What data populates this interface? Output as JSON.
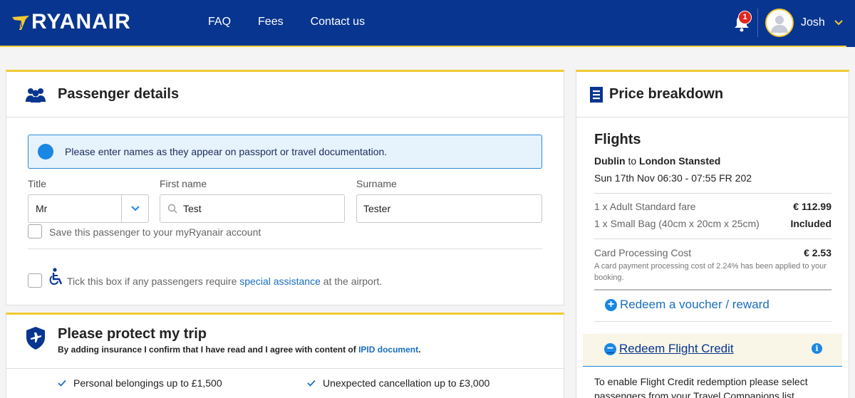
{
  "header": {
    "brand": "RYANAIR",
    "nav": [
      "FAQ",
      "Fees",
      "Contact us"
    ],
    "notification_count": "1",
    "user_name": "Josh"
  },
  "passenger": {
    "title": "Passenger details",
    "info_text": "Please enter names as they appear on passport or travel documentation.",
    "labels": {
      "title": "Title",
      "first_name": "First name",
      "surname": "Surname"
    },
    "values": {
      "title": "Mr",
      "first_name": "Test",
      "surname": "Tester"
    },
    "save_passenger": "Save this passenger to your myRyanair account",
    "assistance": {
      "prefix": "Tick this box if any passengers require ",
      "link": "special assistance",
      "suffix": " at the airport."
    }
  },
  "protect": {
    "title": "Please protect my trip",
    "subtitle_prefix": "By adding insurance I confirm that I have read and I agree with content of ",
    "subtitle_link": "IPID document",
    "subtitle_suffix": ".",
    "benefits": [
      "Personal belongings up to £1,500",
      "Unexpected cancellation up to £3,000"
    ]
  },
  "price": {
    "title": "Price breakdown",
    "section": "Flights",
    "origin": "Dublin",
    "route_join": "to",
    "destination": "London Stansted",
    "flight_time": "Sun 17th Nov 06:30 - 07:55 FR 202",
    "rows": [
      {
        "label": "1 x Adult Standard fare",
        "value": "€ 112.99"
      },
      {
        "label": "1 x Small Bag (40cm x 20cm x 25cm)",
        "value": "Included"
      }
    ],
    "card_cost": {
      "label": "Card Processing Cost",
      "value": "€ 2.53"
    },
    "card_note": "A card payment processing cost of 2.24% has been applied to your booking.",
    "voucher": "Redeem a voucher / reward",
    "credit": "Redeem Flight Credit",
    "credit_text": "To enable Flight Credit redemption please select passengers from your Travel Companions list."
  },
  "colors": {
    "brand_blue": "#073590",
    "accent_yellow": "#f1c933",
    "link_blue": "#1a6ec0",
    "notification_red": "#e1271c"
  }
}
